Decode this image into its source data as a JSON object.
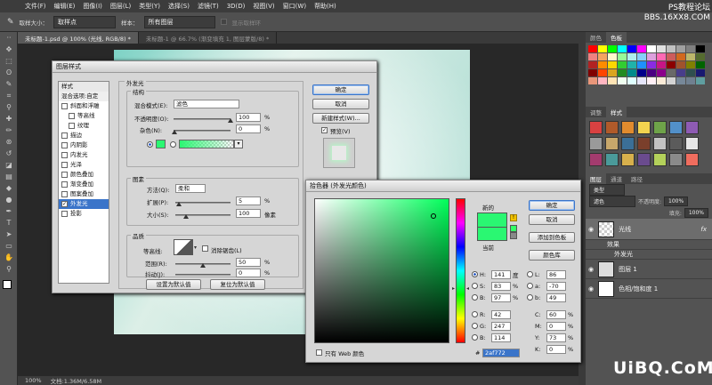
{
  "app": {
    "logo": "Ps",
    "menu": [
      "文件(F)",
      "编辑(E)",
      "图像(I)",
      "图层(L)",
      "类型(Y)",
      "选择(S)",
      "滤镜(T)",
      "3D(D)",
      "视图(V)",
      "窗口(W)",
      "帮助(H)"
    ]
  },
  "watermark_top": {
    "line1": "PS教程论坛",
    "line2": "BBS.16XX8.COM"
  },
  "watermark_bottom": "UiBQ.CoM",
  "options": {
    "sample_size_label": "取样大小：",
    "sample_size_value": "取样点",
    "sample_label": "样本：",
    "sample_value": "所有图层",
    "show_ring": "显示取样环"
  },
  "tabs": [
    {
      "label": "未标题-1.psd @ 100% (光线, RGB/8) *",
      "active": true
    },
    {
      "label": "未标题-1 @ 66.7% (渐变填充 1, 图层蒙版/8) *",
      "active": false
    }
  ],
  "status": {
    "zoom": "100%",
    "doc": "文档:1.36M/6.58M"
  },
  "right_panel": {
    "swatch_tabs": [
      "颜色",
      "色板"
    ],
    "style_tabs": [
      "调整",
      "样式"
    ],
    "layer_tabs": [
      "图层",
      "通道",
      "路径"
    ],
    "filter_kind": "类型",
    "blend_mode": "滤色",
    "opacity_label": "不透明度:",
    "opacity": "100%",
    "fill_label": "填充:",
    "fill": "100%",
    "layers": [
      {
        "name": "光线",
        "fx": "fx"
      },
      {
        "name": "效果",
        "sub": true
      },
      {
        "name": "外发光",
        "sub": true
      },
      {
        "name": "图层 1"
      },
      {
        "name": "色相/饱和度 1"
      }
    ],
    "swatch_colors": [
      "#ff0000",
      "#ffff00",
      "#00ff00",
      "#00ffff",
      "#0000ff",
      "#ff00ff",
      "#ffffff",
      "#e0e0e0",
      "#c0c0c0",
      "#a0a0a0",
      "#808080",
      "#000000",
      "#f08080",
      "#f4a460",
      "#fffacd",
      "#98fb98",
      "#afeeee",
      "#87cefa",
      "#dda0dd",
      "#ff69b4",
      "#cd5c5c",
      "#d2691e",
      "#bdb76b",
      "#556b2f",
      "#b22222",
      "#ff8c00",
      "#ffd700",
      "#32cd32",
      "#20b2aa",
      "#1e90ff",
      "#8a2be2",
      "#c71585",
      "#8b0000",
      "#a0522d",
      "#808000",
      "#006400",
      "#800000",
      "#ff4500",
      "#daa520",
      "#228b22",
      "#008b8b",
      "#00008b",
      "#4b0082",
      "#8b008b",
      "#696969",
      "#483d8b",
      "#2f4f4f",
      "#191970",
      "#e9967a",
      "#ffb6c1",
      "#ffe4b5",
      "#f0fff0",
      "#e0ffff",
      "#e6e6fa",
      "#fff0f5",
      "#faebd7",
      "#d3d3d3",
      "#778899",
      "#708090",
      "#5f9ea0"
    ],
    "style_colors": [
      "#d94141",
      "#b05a2a",
      "#e08b2e",
      "#f2d34f",
      "#6ea349",
      "#5290c9",
      "#8e5bb3",
      "#9a9a9a",
      "#c7a76b",
      "#3b6f97",
      "#7a3f2b",
      "#c2c2c2",
      "#5b5b5b",
      "#e6e6e6",
      "#a33b6e",
      "#4a9a9a",
      "#d7b04c",
      "#6a4b8e",
      "#b3d15a",
      "#8a8a8a",
      "#f06d5e"
    ]
  },
  "layer_style": {
    "title": "图层样式",
    "styles_header": "样式",
    "blend_options": "混合选项:自定",
    "items": [
      {
        "label": "斜面和浮雕",
        "checked": false
      },
      {
        "label": "等高线",
        "checked": false,
        "indent": true
      },
      {
        "label": "纹理",
        "checked": false,
        "indent": true
      },
      {
        "label": "描边",
        "checked": false
      },
      {
        "label": "内阴影",
        "checked": false
      },
      {
        "label": "内发光",
        "checked": false
      },
      {
        "label": "光泽",
        "checked": false
      },
      {
        "label": "颜色叠加",
        "checked": false
      },
      {
        "label": "渐变叠加",
        "checked": false
      },
      {
        "label": "图案叠加",
        "checked": false
      },
      {
        "label": "外发光",
        "checked": true,
        "selected": true
      },
      {
        "label": "投影",
        "checked": false
      }
    ],
    "section": "外发光",
    "structure": "结构",
    "blend_mode_label": "混合模式(E):",
    "blend_mode": "滤色",
    "opacity_label": "不透明度(O):",
    "opacity": "100",
    "noise_label": "杂色(N):",
    "noise": "0",
    "percent": "%",
    "elements": "图素",
    "method_label": "方法(Q):",
    "method": "柔和",
    "spread_label": "扩展(P):",
    "spread": "5",
    "size_label": "大小(S):",
    "size": "100",
    "px": "像素",
    "quality": "品质",
    "contour_label": "等高线:",
    "anti_alias": "消除锯齿(L)",
    "range_label": "范围(R):",
    "range": "50",
    "jitter_label": "抖动(J):",
    "jitter": "0",
    "make_default": "设置为默认值",
    "reset_default": "复位为默认值",
    "ok": "确定",
    "cancel": "取消",
    "new_style": "新建样式(W)...",
    "preview": "预览(V)",
    "glow_color": "#2af772"
  },
  "color_picker": {
    "title": "拾色器 (外发光颜色)",
    "new_label": "新的",
    "current_label": "当前",
    "ok": "确定",
    "cancel": "取消",
    "add_swatch": "添加到色板",
    "libraries": "颜色库",
    "hsb": [
      {
        "k": "H:",
        "v": "141",
        "u": "度",
        "checked": true
      },
      {
        "k": "S:",
        "v": "83",
        "u": "%"
      },
      {
        "k": "B:",
        "v": "97",
        "u": "%"
      }
    ],
    "rgb": [
      {
        "k": "R:",
        "v": "42"
      },
      {
        "k": "G:",
        "v": "247"
      },
      {
        "k": "B:",
        "v": "114"
      }
    ],
    "lab": [
      {
        "k": "L:",
        "v": "86"
      },
      {
        "k": "a:",
        "v": "-70"
      },
      {
        "k": "b:",
        "v": "49"
      }
    ],
    "cmyk": [
      {
        "k": "C:",
        "v": "60",
        "u": "%"
      },
      {
        "k": "M:",
        "v": "0",
        "u": "%"
      },
      {
        "k": "Y:",
        "v": "73",
        "u": "%"
      },
      {
        "k": "K:",
        "v": "0",
        "u": "%"
      }
    ],
    "web_only": "只有 Web 颜色",
    "hash": "#",
    "hex": "2af772",
    "color": "#2af772",
    "hue_base": "#00ff5a"
  }
}
